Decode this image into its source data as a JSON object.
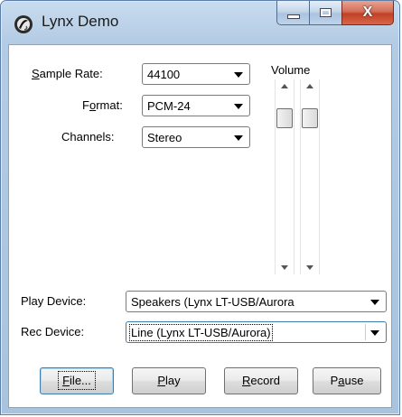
{
  "window": {
    "title": "Lynx Demo",
    "caption": {
      "minimize_icon": "minimize-icon",
      "maximize_icon": "maximize-icon",
      "close_glyph": "X"
    }
  },
  "form": {
    "sample_rate": {
      "label_prefix": "",
      "label_mnemonic": "S",
      "label_rest": "ample Rate:",
      "value": "44100"
    },
    "format": {
      "label_prefix": "F",
      "label_mnemonic": "o",
      "label_rest": "rmat:",
      "value": "PCM-24"
    },
    "channels": {
      "label": "Channels:",
      "value": "Stereo"
    },
    "volume": {
      "label": "Volume"
    },
    "play_device": {
      "label": "Play Device:",
      "value": "Speakers (Lynx LT-USB/Aurora"
    },
    "rec_device": {
      "label": "Rec Device:",
      "value": "Line (Lynx LT-USB/Aurora)"
    }
  },
  "buttons": {
    "file": {
      "mnemonic": "F",
      "rest": "ile..."
    },
    "play": {
      "mnemonic": "P",
      "rest": "lay"
    },
    "record": {
      "mnemonic": "R",
      "rest": "ecord"
    },
    "pause": {
      "prefix": "P",
      "mnemonic": "a",
      "rest": "use"
    }
  },
  "colors": {
    "frame": "#b3cbe4",
    "close_button": "#c04125",
    "focus_border": "#3c7fb1"
  }
}
